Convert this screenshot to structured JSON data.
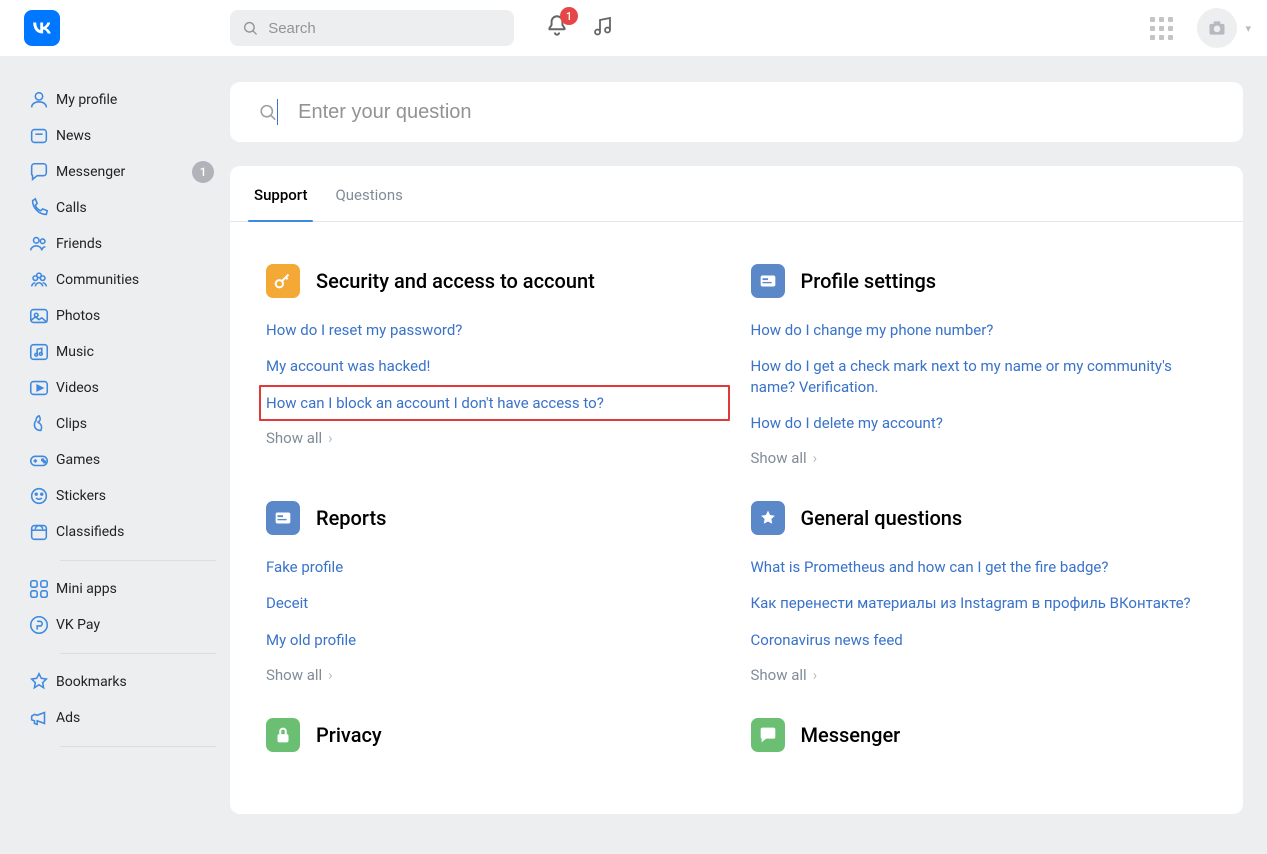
{
  "header": {
    "search_placeholder": "Search",
    "notif_count": "1"
  },
  "sidebar": [
    {
      "icon": "user",
      "label": "My profile"
    },
    {
      "icon": "news",
      "label": "News"
    },
    {
      "icon": "chat",
      "label": "Messenger",
      "badge": "1"
    },
    {
      "icon": "phone",
      "label": "Calls"
    },
    {
      "icon": "friends",
      "label": "Friends"
    },
    {
      "icon": "community",
      "label": "Communities"
    },
    {
      "icon": "photo",
      "label": "Photos"
    },
    {
      "icon": "music2",
      "label": "Music"
    },
    {
      "icon": "video",
      "label": "Videos"
    },
    {
      "icon": "clips",
      "label": "Clips"
    },
    {
      "icon": "games",
      "label": "Games"
    },
    {
      "icon": "stickers",
      "label": "Stickers"
    },
    {
      "icon": "market",
      "label": "Classifieds"
    },
    {
      "sep": true
    },
    {
      "icon": "mini",
      "label": "Mini apps"
    },
    {
      "icon": "pay",
      "label": "VK Pay"
    },
    {
      "sep": true
    },
    {
      "icon": "bookmark",
      "label": "Bookmarks"
    },
    {
      "icon": "ads",
      "label": "Ads"
    },
    {
      "sep": true
    }
  ],
  "question_placeholder": "Enter your question",
  "tabs": [
    {
      "label": "Support",
      "active": true
    },
    {
      "label": "Questions",
      "active": false
    }
  ],
  "sections": [
    {
      "icon": "key",
      "icon_color": "orange",
      "title": "Security and access to account",
      "links": [
        "How do I reset my password?",
        "My account was hacked!",
        "How can I block an account I don't have access to?"
      ],
      "highlight_index": 2,
      "show_all": "Show all"
    },
    {
      "icon": "card",
      "icon_color": "blue",
      "title": "Profile settings",
      "links": [
        "How do I change my phone number?",
        "How do I get a check mark next to my name or my community's name? Verification.",
        "How do I delete my account?"
      ],
      "show_all": "Show all"
    },
    {
      "icon": "card",
      "icon_color": "blue",
      "title": "Reports",
      "links": [
        "Fake profile",
        "Deceit",
        "My old profile"
      ],
      "show_all": "Show all"
    },
    {
      "icon": "star",
      "icon_color": "blue",
      "title": "General questions",
      "links": [
        "What is Prometheus and how can I get the fire badge?",
        "Как перенести материалы из Instagram в профиль ВКонтакте?",
        "Coronavirus news feed"
      ],
      "show_all": "Show all"
    },
    {
      "icon": "lock",
      "icon_color": "green",
      "title": "Privacy",
      "links": [],
      "show_all": ""
    },
    {
      "icon": "dialog",
      "icon_color": "green",
      "title": "Messenger",
      "links": [],
      "show_all": ""
    }
  ]
}
